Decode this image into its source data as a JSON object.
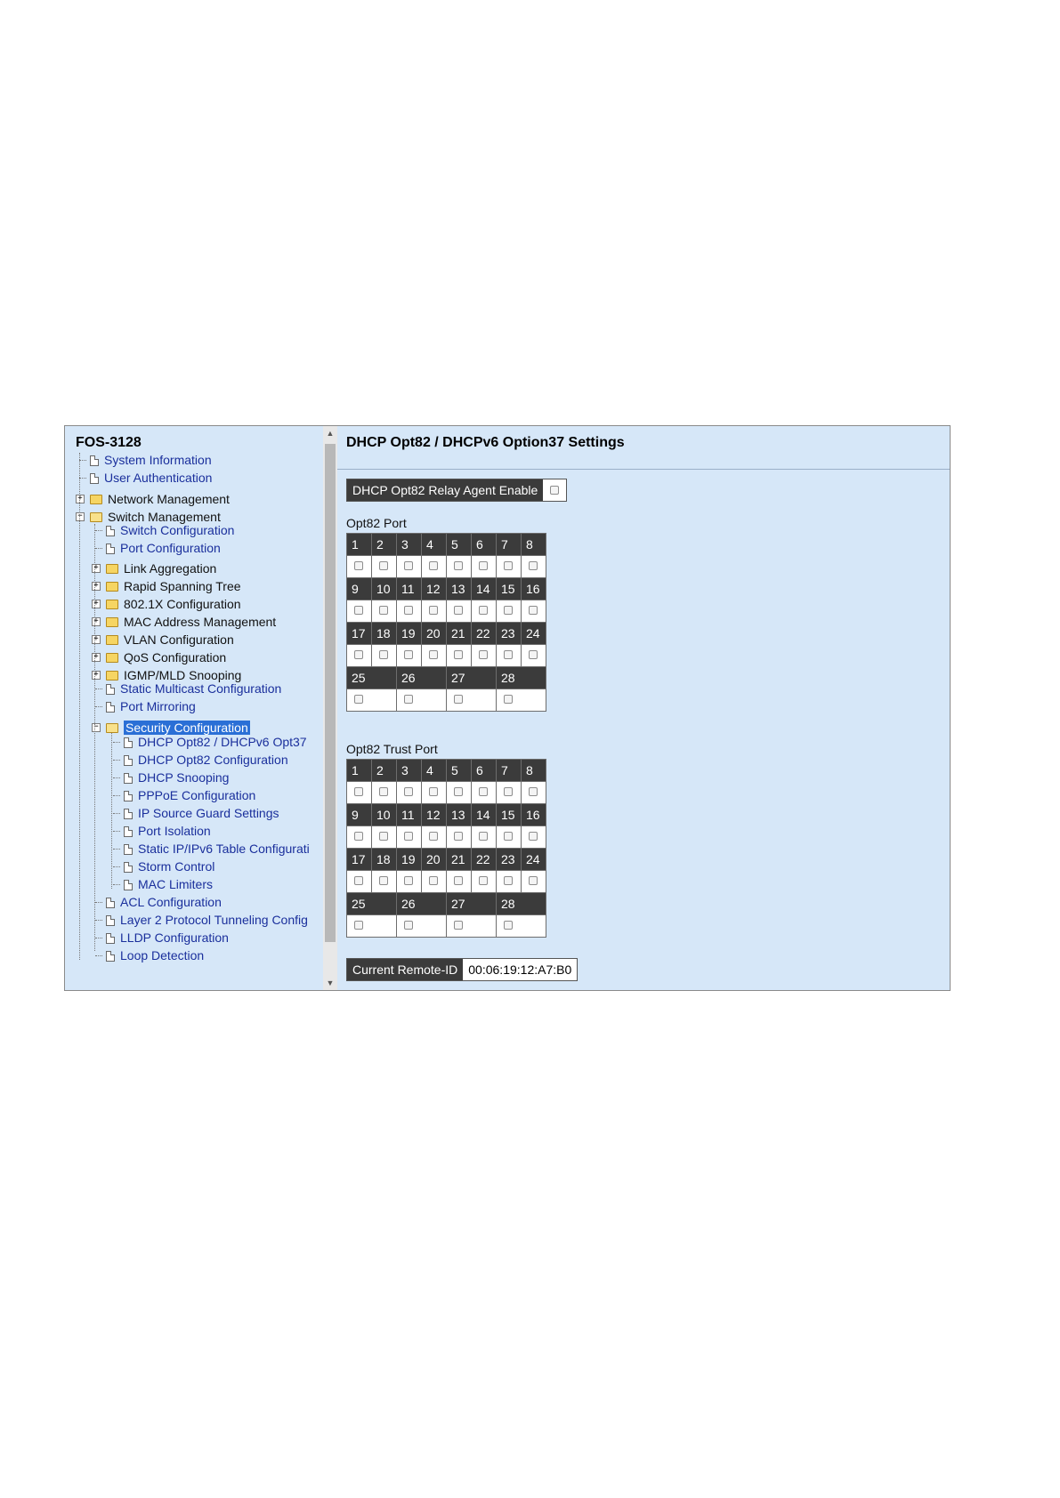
{
  "device_name": "FOS-3128",
  "tree": [
    {
      "label": "System Information",
      "type": "page",
      "level": 0
    },
    {
      "label": "User Authentication",
      "type": "page",
      "level": 0
    },
    {
      "label": "Network Management",
      "type": "folder",
      "level": 0,
      "expanded": false
    },
    {
      "label": "Switch Management",
      "type": "folder",
      "level": 0,
      "expanded": true
    },
    {
      "label": "Switch Configuration",
      "type": "page",
      "level": 1
    },
    {
      "label": "Port Configuration",
      "type": "page",
      "level": 1
    },
    {
      "label": "Link Aggregation",
      "type": "folder",
      "level": 1,
      "expanded": false
    },
    {
      "label": "Rapid Spanning Tree",
      "type": "folder",
      "level": 1,
      "expanded": false
    },
    {
      "label": "802.1X Configuration",
      "type": "folder",
      "level": 1,
      "expanded": false
    },
    {
      "label": "MAC Address Management",
      "type": "folder",
      "level": 1,
      "expanded": false
    },
    {
      "label": "VLAN Configuration",
      "type": "folder",
      "level": 1,
      "expanded": false
    },
    {
      "label": "QoS Configuration",
      "type": "folder",
      "level": 1,
      "expanded": false
    },
    {
      "label": "IGMP/MLD Snooping",
      "type": "folder",
      "level": 1,
      "expanded": false
    },
    {
      "label": "Static Multicast Configuration",
      "type": "page",
      "level": 1
    },
    {
      "label": "Port Mirroring",
      "type": "page",
      "level": 1
    },
    {
      "label": "Security Configuration",
      "type": "folder",
      "level": 1,
      "expanded": true,
      "selected": true
    },
    {
      "label": "DHCP Opt82 / DHCPv6 Opt37",
      "type": "page",
      "level": 2
    },
    {
      "label": "DHCP Opt82 Configuration",
      "type": "page",
      "level": 2
    },
    {
      "label": "DHCP Snooping",
      "type": "page",
      "level": 2
    },
    {
      "label": "PPPoE Configuration",
      "type": "page",
      "level": 2
    },
    {
      "label": "IP Source Guard Settings",
      "type": "page",
      "level": 2
    },
    {
      "label": "Port Isolation",
      "type": "page",
      "level": 2
    },
    {
      "label": "Static IP/IPv6 Table Configurati",
      "type": "page",
      "level": 2
    },
    {
      "label": "Storm Control",
      "type": "page",
      "level": 2
    },
    {
      "label": "MAC Limiters",
      "type": "page",
      "level": 2
    },
    {
      "label": "ACL Configuration",
      "type": "page",
      "level": 1
    },
    {
      "label": "Layer 2 Protocol Tunneling Config",
      "type": "page",
      "level": 1
    },
    {
      "label": "LLDP Configuration",
      "type": "page",
      "level": 1
    },
    {
      "label": "Loop Detection",
      "type": "page",
      "level": 1
    }
  ],
  "page_title": "DHCP Opt82 / DHCPv6 Option37 Settings",
  "relay_agent_label": "DHCP Opt82 Relay Agent Enable",
  "opt82_port_caption": "Opt82 Port",
  "opt82_trust_port_caption": "Opt82 Trust Port",
  "port_rows": [
    [
      "1",
      "2",
      "3",
      "4",
      "5",
      "6",
      "7",
      "8"
    ],
    [
      "9",
      "10",
      "11",
      "12",
      "13",
      "14",
      "15",
      "16"
    ],
    [
      "17",
      "18",
      "19",
      "20",
      "21",
      "22",
      "23",
      "24"
    ]
  ],
  "wide_ports": [
    "25",
    "26",
    "27",
    "28"
  ],
  "remote_id_label": "Current Remote-ID",
  "remote_id_value": "00:06:19:12:A7:B0",
  "colors": {
    "panel_bg": "#d6e7f8",
    "header_cell": "#3b3b3b",
    "link_text": "#1a2f9c",
    "selected_bg": "#2a6fd6"
  }
}
